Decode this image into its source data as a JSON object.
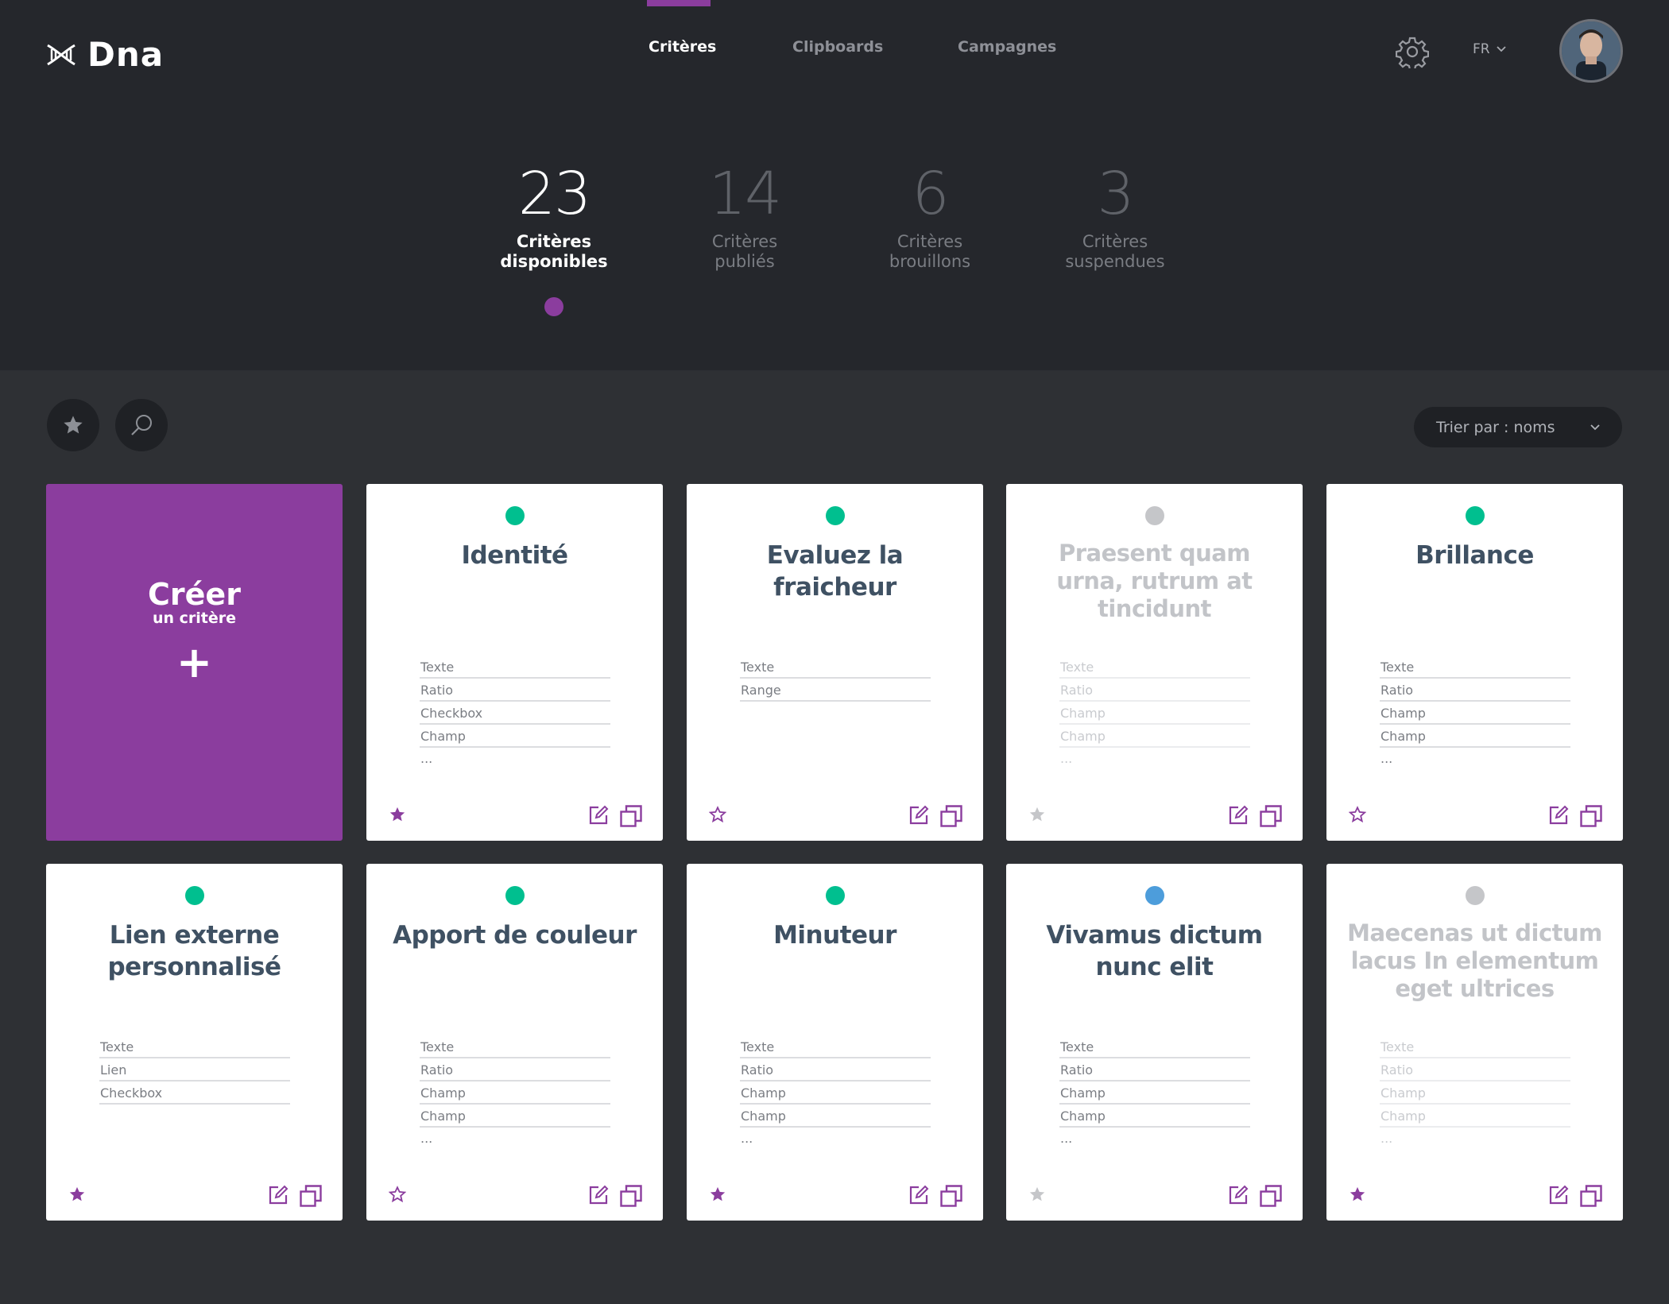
{
  "brand": {
    "name": "Dna"
  },
  "nav": {
    "items": [
      {
        "label": "Critères",
        "active": true
      },
      {
        "label": "Clipboards",
        "active": false
      },
      {
        "label": "Campagnes",
        "active": false
      }
    ],
    "language": "FR"
  },
  "stats": [
    {
      "value": "23",
      "label_line1": "Critères",
      "label_line2": "disponibles",
      "active": true
    },
    {
      "value": "14",
      "label_line1": "Critères",
      "label_line2": "publiés",
      "active": false
    },
    {
      "value": "6",
      "label_line1": "Critères",
      "label_line2": "brouillons",
      "active": false
    },
    {
      "value": "3",
      "label_line1": "Critères",
      "label_line2": "suspendues",
      "active": false
    }
  ],
  "toolbar": {
    "sort_label": "Trier par : noms"
  },
  "create_card": {
    "title": "Créer",
    "subtitle": "un critère",
    "plus": "+"
  },
  "colors": {
    "accent": "#8b3d9e",
    "status_green": "#00bf8f",
    "status_gray": "#c5c6c9",
    "status_blue": "#4d9ddb",
    "header_bg": "#25272c",
    "page_bg": "#2e3034",
    "title_text": "#3f5163"
  },
  "cards": [
    {
      "title": "Identité",
      "status": "green",
      "fields": [
        "Texte",
        "Ratio",
        "Checkbox",
        "Champ"
      ],
      "more": "...",
      "starred": true,
      "muted": false
    },
    {
      "title": "Evaluez la fraicheur",
      "status": "green",
      "fields": [
        "Texte",
        "Range"
      ],
      "more": "",
      "starred": false,
      "muted": false
    },
    {
      "title": "Praesent quam urna, rutrum at tincidunt",
      "status": "gray",
      "fields": [
        "Texte",
        "Ratio",
        "Champ",
        "Champ"
      ],
      "more": "...",
      "starred": false,
      "muted": true
    },
    {
      "title": "Brillance",
      "status": "green",
      "fields": [
        "Texte",
        "Ratio",
        "Champ",
        "Champ"
      ],
      "more": "...",
      "starred": false,
      "muted": false
    },
    {
      "title": "Lien externe personnalisé",
      "status": "green",
      "fields": [
        "Texte",
        "Lien",
        "Checkbox"
      ],
      "more": "",
      "starred": true,
      "muted": false
    },
    {
      "title": "Apport de couleur",
      "status": "green",
      "fields": [
        "Texte",
        "Ratio",
        "Champ",
        "Champ"
      ],
      "more": "...",
      "starred": false,
      "muted": false
    },
    {
      "title": "Minuteur",
      "status": "green",
      "fields": [
        "Texte",
        "Ratio",
        "Champ",
        "Champ"
      ],
      "more": "...",
      "starred": true,
      "muted": false
    },
    {
      "title": "Vivamus dictum nunc elit",
      "status": "blue",
      "fields": [
        "Texte",
        "Ratio",
        "Champ",
        "Champ"
      ],
      "more": "...",
      "starred": false,
      "muted": false
    },
    {
      "title": "Maecenas ut dictum lacus In elementum eget ultrices",
      "status": "gray",
      "fields": [
        "Texte",
        "Ratio",
        "Champ",
        "Champ"
      ],
      "more": "...",
      "starred": true,
      "muted": true
    }
  ]
}
